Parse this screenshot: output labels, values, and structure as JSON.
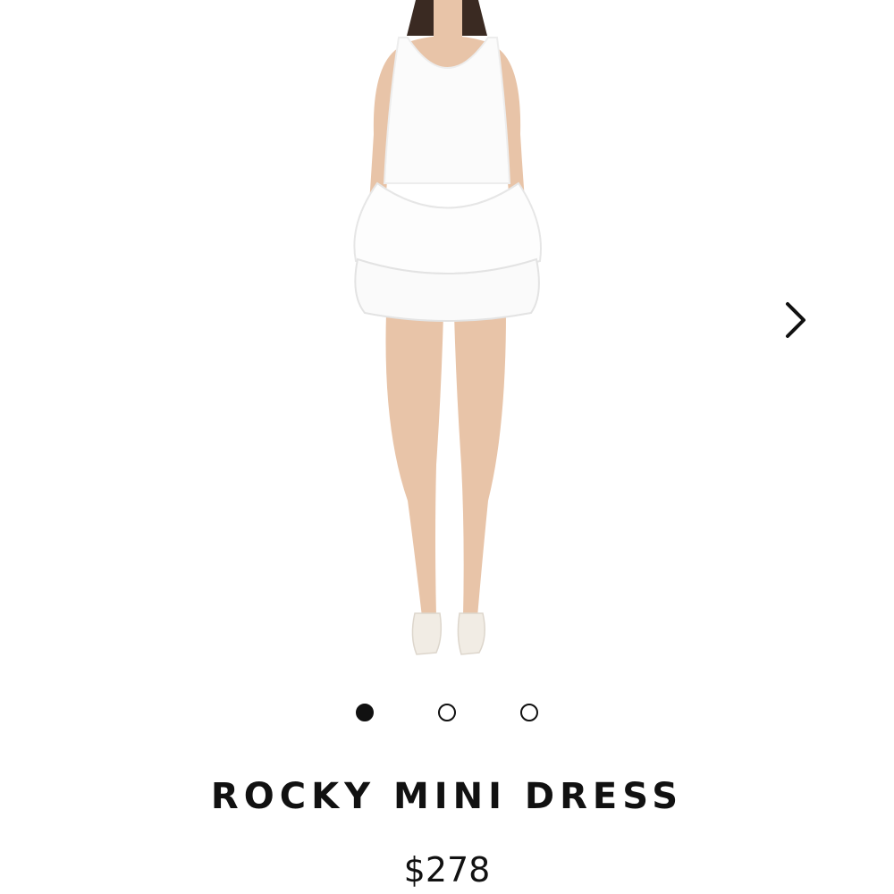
{
  "product": {
    "name": "ROCKY MINI DRESS",
    "price": "$278"
  },
  "carousel": {
    "image_icon": "dress-product-photo",
    "next_icon": "chevron-right-icon",
    "dots": [
      {
        "state": "active"
      },
      {
        "state": "inactive"
      },
      {
        "state": "inactive"
      }
    ]
  },
  "colors": {
    "text": "#111111",
    "background": "#ffffff",
    "dress": "#fbfbfb",
    "skin": "#e8c4a8",
    "hair": "#3a2a22",
    "shoes": "#f1ece4"
  }
}
